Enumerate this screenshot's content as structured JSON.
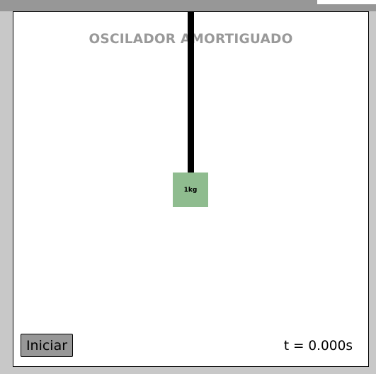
{
  "app": {
    "title": "OSCILADOR AMORTIGUADO"
  },
  "mass": {
    "label": "1kg"
  },
  "controls": {
    "start_label": "Iniciar"
  },
  "readout": {
    "time_text": "t = 0.000s"
  },
  "colors": {
    "mass": "#8fbc8f",
    "title": "#999999",
    "button": "#979797",
    "frame": "#c8c8c8"
  }
}
